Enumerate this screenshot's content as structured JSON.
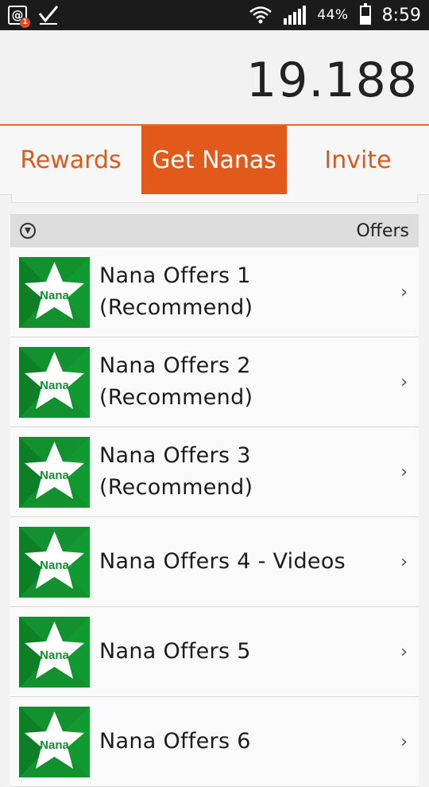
{
  "statusbar": {
    "battery_text": "44%",
    "time": "8:59"
  },
  "balance": {
    "value": "19.188"
  },
  "tabs": [
    {
      "label": "Rewards"
    },
    {
      "label": "Get Nanas"
    },
    {
      "label": "Invite"
    }
  ],
  "section": {
    "title": "Offers"
  },
  "offers": [
    {
      "title": "Nana Offers 1",
      "subtitle": "(Recommend)",
      "icon_label": "Nana"
    },
    {
      "title": "Nana Offers 2",
      "subtitle": "(Recommend)",
      "icon_label": "Nana"
    },
    {
      "title": "Nana Offers 3",
      "subtitle": "(Recommend)",
      "icon_label": "Nana"
    },
    {
      "title": "Nana Offers 4 - Videos",
      "subtitle": "",
      "icon_label": "Nana"
    },
    {
      "title": "Nana Offers 5",
      "subtitle": "",
      "icon_label": "Nana"
    },
    {
      "title": "Nana Offers 6",
      "subtitle": "",
      "icon_label": "Nana"
    }
  ],
  "colors": {
    "accent": "#e15a1b",
    "icon_green": "#13912f"
  }
}
